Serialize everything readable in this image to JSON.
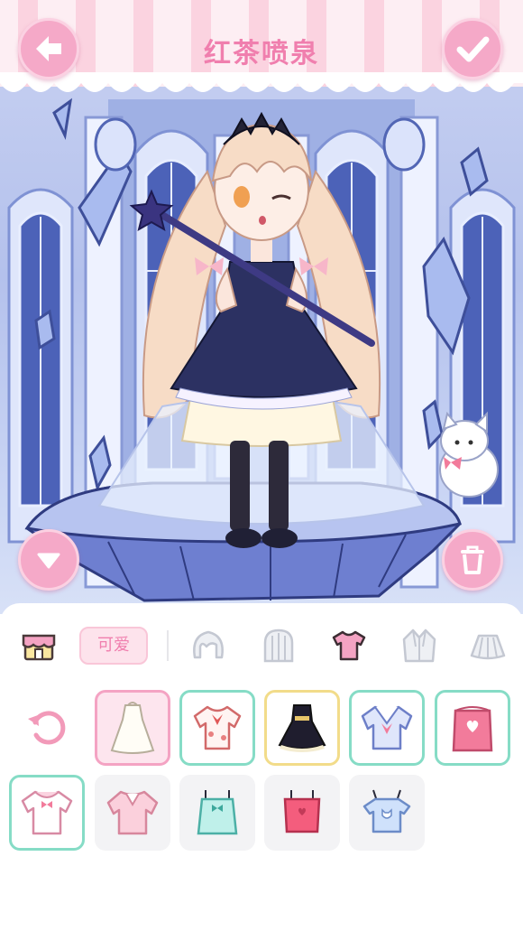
{
  "header": {
    "title": "红茶喷泉",
    "back_icon": "arrow-left-icon",
    "confirm_icon": "checkmark-icon"
  },
  "scene": {
    "collapse_icon": "triangle-down-icon",
    "delete_icon": "trash-icon"
  },
  "toolbar": {
    "shop_icon": "shop-icon",
    "filter_label": "可爱",
    "tabs": [
      {
        "icon": "hair-front-icon",
        "selected": false
      },
      {
        "icon": "hair-back-icon",
        "selected": false
      },
      {
        "icon": "shirt-icon",
        "selected": true
      },
      {
        "icon": "jacket-icon",
        "selected": false
      },
      {
        "icon": "skirt-icon",
        "selected": false
      }
    ]
  },
  "wardrobe": {
    "reset_icon": "refresh-icon",
    "items": [
      {
        "icon": "white-gown-icon",
        "state": "selected"
      },
      {
        "icon": "floral-blouse-icon",
        "state": "owned"
      },
      {
        "icon": "black-dress-icon",
        "state": "gold"
      },
      {
        "icon": "sailor-top-icon",
        "state": "owned"
      },
      {
        "icon": "pink-heart-top-icon",
        "state": "owned"
      },
      {
        "icon": "white-bow-tee-icon",
        "state": "owned"
      },
      {
        "icon": "pink-polo-icon",
        "state": "locked"
      },
      {
        "icon": "mint-camisole-icon",
        "state": "locked"
      },
      {
        "icon": "red-tank-icon",
        "state": "locked"
      },
      {
        "icon": "blue-cat-cami-icon",
        "state": "locked"
      }
    ]
  },
  "colors": {
    "accent_pink": "#f07fae",
    "button_pink": "#f5a9c8",
    "owned_border": "#86dcc6",
    "gold_border": "#f2dc8a"
  }
}
